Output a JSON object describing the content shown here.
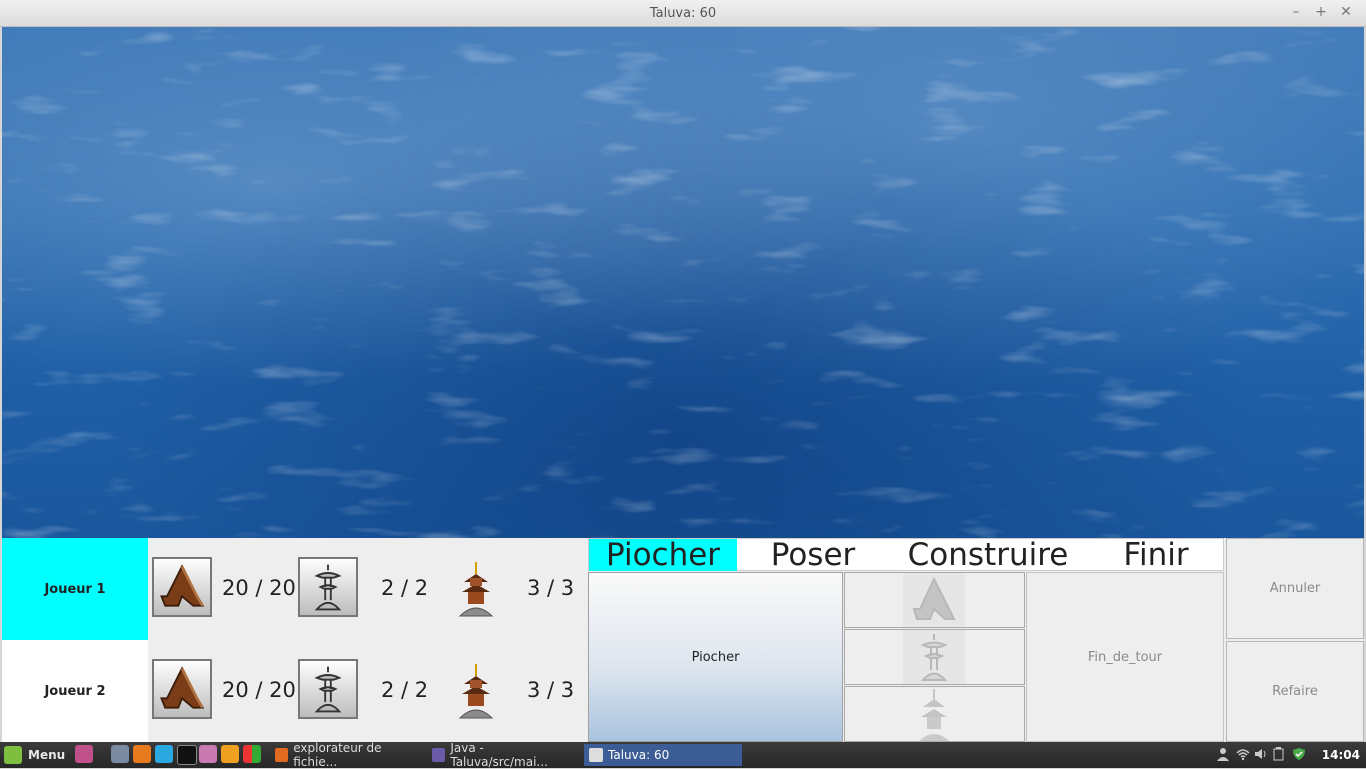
{
  "window": {
    "title": "Taluva: 60",
    "controls": {
      "minimize": "–",
      "maximize": "+",
      "close": "✕"
    }
  },
  "players": [
    {
      "name": "Joueur 1",
      "huts": "20 / 20",
      "temples": "2 / 2",
      "towers": "3 / 3",
      "active": true
    },
    {
      "name": "Joueur 2",
      "huts": "20 / 20",
      "temples": "2 / 2",
      "towers": "3 / 3",
      "active": false
    }
  ],
  "phases": {
    "items": [
      "Piocher",
      "Poser",
      "Construire",
      "Finir"
    ],
    "active": "Piocher"
  },
  "actions": {
    "piocher": "Piocher",
    "fin_de_tour": "Fin_de_tour",
    "annuler": "Annuler",
    "refaire": "Refaire"
  },
  "taskbar": {
    "menu_label": "Menu",
    "windows": [
      {
        "label": "explorateur de fichie...",
        "active": false
      },
      {
        "label": "Java - Taluva/src/mai...",
        "active": false
      },
      {
        "label": "Taluva: 60",
        "active": true
      }
    ],
    "clock": "14:04"
  },
  "colors": {
    "active_player": "#00ffff",
    "active_phase": "#00ffff",
    "sea": "#1f5fa6"
  }
}
